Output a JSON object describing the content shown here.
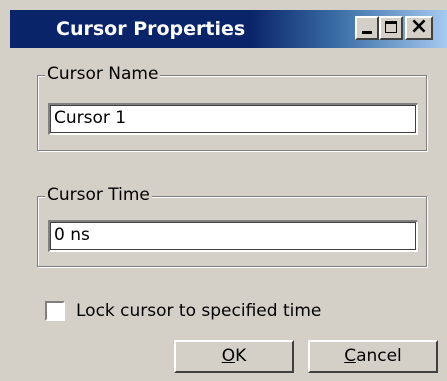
{
  "window": {
    "title": "Cursor Properties",
    "controls": {
      "minimize": "minimize-icon",
      "maximize": "maximize-icon",
      "close": "close-icon",
      "close_glyph": "×"
    }
  },
  "cursor_name": {
    "label": "Cursor Name",
    "value": "Cursor 1"
  },
  "cursor_time": {
    "label": "Cursor Time",
    "value": "0 ns"
  },
  "lock": {
    "label": "Lock cursor to specified time",
    "checked": false
  },
  "buttons": {
    "ok": {
      "accel": "O",
      "rest": "K"
    },
    "cancel": {
      "accel": "C",
      "rest": "ancel"
    }
  },
  "colors": {
    "titlebar_start": "#0a246a",
    "titlebar_end": "#a6caf0",
    "face": "#d4d0c8"
  }
}
